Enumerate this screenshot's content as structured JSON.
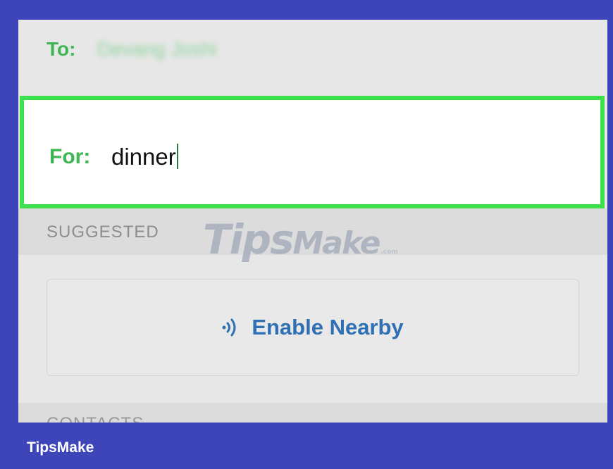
{
  "message": {
    "to_label": "To:",
    "to_value": "Devang Joshi",
    "for_label": "For:",
    "for_value": "dinner"
  },
  "suggested": {
    "header": "SUGGESTED",
    "enable_nearby_label": "Enable Nearby",
    "enable_nearby_icon": "nearby-waves-icon"
  },
  "contacts": {
    "header": "CONTACTS"
  },
  "watermark": {
    "main": "Tips",
    "second": "Make",
    "suffix": ".com"
  },
  "footer": {
    "brand": "TipsMake"
  },
  "colors": {
    "frame_background": "#3d45b8",
    "label_green": "#3db653",
    "highlight_border": "#3fe04b",
    "link_blue": "#2f6fb3"
  }
}
